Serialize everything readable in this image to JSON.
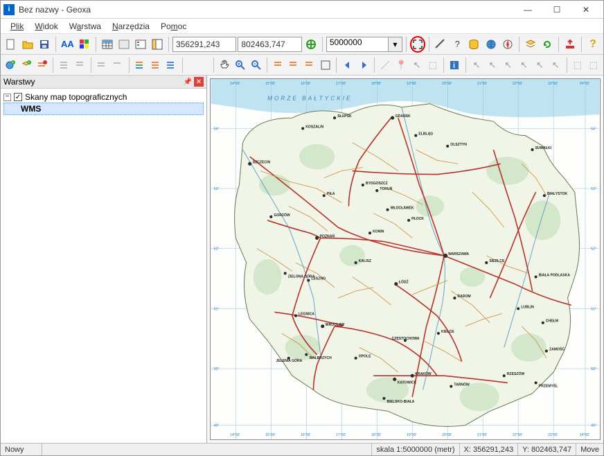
{
  "title": "Bez nazwy - Geoxa",
  "menu": {
    "plik": "Plik",
    "widok": "Widok",
    "warstwa": "Warstwa",
    "narzedzia": "Narzędzia",
    "pomoc": "Pomoc"
  },
  "coords": {
    "x": "356291,243",
    "y": "802463,747"
  },
  "scale": "5000000",
  "layers_panel_title": "Warstwy",
  "tree": {
    "root": "Skany map topograficznych",
    "child": "WMS"
  },
  "status": {
    "left": "Nowy",
    "scale": "skala 1:5000000 (metr)",
    "x": "X: 356291,243",
    "y": "Y: 802463,747",
    "mode": "Move"
  },
  "map": {
    "sea_label": "MORZE BAŁTYCKIE",
    "lon_ticks": [
      "14°00'",
      "15°00'",
      "16°00'",
      "17°00'",
      "18°00'",
      "19°00'",
      "20°00'",
      "21°00'",
      "22°00'",
      "23°00'",
      "24°00'"
    ],
    "lat_ticks": [
      "54°",
      "53°",
      "52°",
      "51°",
      "50°",
      "49°"
    ],
    "cities": {
      "warszawa": "WARSZAWA",
      "lodz": "ŁÓDŹ",
      "krakow": "KRAKÓW",
      "wroclaw": "WROCŁAW",
      "poznan": "POZNAŃ",
      "gdansk": "GDAŃSK",
      "szczecin": "SZCZECIN",
      "bydgoszcz": "BYDGOSZCZ",
      "lublin": "LUBLIN",
      "bialystok": "BIAŁYSTOK",
      "katowice": "KATOWICE",
      "rzeszow": "RZESZÓW",
      "olsztyn": "OLSZTYN",
      "kielce": "KIELCE",
      "torun": "TORUŃ",
      "opole": "OPOLE",
      "zielona": "ZIELONA GÓRA",
      "gorzow": "GORZÓW",
      "koszalin": "KOSZALIN",
      "slupsk": "SŁUPSK",
      "elblag": "ELBLĄG",
      "plock": "PŁOCK",
      "radom": "RADOM",
      "kalisz": "KALISZ",
      "legnica": "LEGNICA",
      "walbrzych": "WAŁBRZYCH",
      "czestochowa": "CZĘSTOCHOWA",
      "bielsko": "BIELSKO-BIAŁA",
      "tarnow": "TARNÓW",
      "wloclawek": "WŁOCŁAWEK",
      "suwalki": "SUWAŁKI",
      "siedlce": "SIEDLCE",
      "biala_podl": "BIAŁA PODLASKA",
      "chelm": "CHEŁM",
      "zamosc": "ZAMOŚĆ",
      "przemysl": "PRZEMYŚL",
      "konin": "KONIN",
      "pila": "PIŁA",
      "leszno": "LESZNO",
      "jelenia": "JELENIA GÓRA"
    }
  }
}
